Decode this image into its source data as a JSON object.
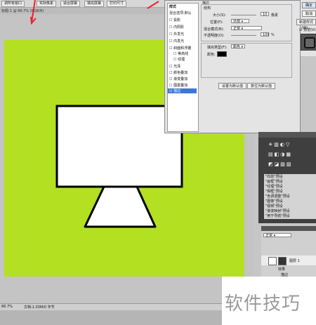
{
  "options_bar": {
    "buttons": [
      "调所有窗口",
      "实际像素",
      "适合屏幕",
      "填充屏幕",
      "打印尺寸"
    ]
  },
  "document": {
    "tab_title": "标题-1 @ 66.7% (RGB/8)",
    "zoom": "66.7%",
    "doc_info": "文档:1.03M/0 字节"
  },
  "layer_style_dialog": {
    "styles_header": "样式",
    "blend_options": "混合选项:默认",
    "style_items": [
      "投影",
      "内阴影",
      "外发光",
      "内发光",
      "斜面和浮雕",
      "等高线",
      "纹理",
      "光泽",
      "颜色叠加",
      "渐变叠加",
      "图案叠加",
      "描边"
    ],
    "selected_item": "描边",
    "section_title": "描边",
    "structure_title": "结构",
    "size_label": "大小(S):",
    "size_value": "10",
    "size_unit": "像素",
    "position_label": "位置(P):",
    "position_value": "外部",
    "blend_mode_label": "混合模式(B):",
    "blend_mode_value": "正常",
    "opacity_label": "不透明度(O):",
    "opacity_value": "100",
    "opacity_unit": "%",
    "fill_type_label": "填充类型(F):",
    "fill_type_value": "颜色",
    "color_label": "颜色:",
    "stroke_color": "#000000",
    "set_default_button": "设置为默认值",
    "reset_default_button": "复位为默认值",
    "ok_button": "确定",
    "cancel_button": "取消",
    "new_style_button": "新建样式(W)...",
    "preview_label": "预览(V)"
  },
  "styles_panel": {
    "items": [
      "\"向前\"预设",
      "\"画框\"预设",
      "\"纹理\"预设",
      "\"相框\"预设",
      "\"色调调整\"预设",
      "\"图像\"预设",
      "\"视频\"预设",
      "\"渐变映射\"预设",
      "\"用于导航\"预设"
    ]
  },
  "layers_panel": {
    "blend_mode": "正常",
    "layer_name": "图层 1",
    "effects_label": "效果",
    "effect_item": "描边"
  },
  "watermark": {
    "text": "软件技巧"
  },
  "colors": {
    "canvas_green": "#b3e021",
    "arrow_red": "#e8232b",
    "selection_blue": "#3d78d6"
  }
}
